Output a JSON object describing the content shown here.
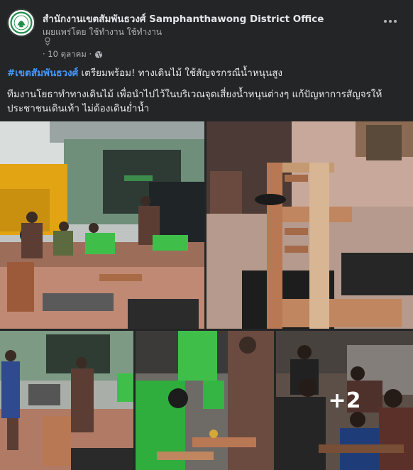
{
  "post": {
    "page_name": "สำนักงานเขตสัมพันธวงศ์ Samphanthawong District Office",
    "publisher_line": "เผยแพร่โดย ใช้ทำงาน ใช้ทำงาน",
    "date": "· 10 ตุลาคม ·",
    "hashtag": "#เขตสัมพันธวงศ์",
    "headline": " เตรียมพร้อม! ทางเดินไม้ ใช้สัญจรกรณีน้ำหนุนสูง",
    "body": "ทีมงานโยธาทำทางเดินไม้ เพื่อนำไปไว้ในบริเวณจุดเสี่ยงน้ำหนุนต่างๆ แก้ปัญหาการสัญจรให้ประชาชนเดินเท้า ไม่ต้องเดินย่ำน้ำ",
    "more_photos": "+2"
  },
  "icons": {
    "avatar": "district-seal-logo",
    "privacy": "globe-icon",
    "publisher_sub": "person-outline-icon",
    "menu": "more-horizontal-icon"
  },
  "colors": {
    "background": "#242526",
    "text": "#e4e6eb",
    "secondary_text": "#b0b3b8",
    "hashtag": "#4599ff",
    "seal_green": "#1f8f4a"
  }
}
